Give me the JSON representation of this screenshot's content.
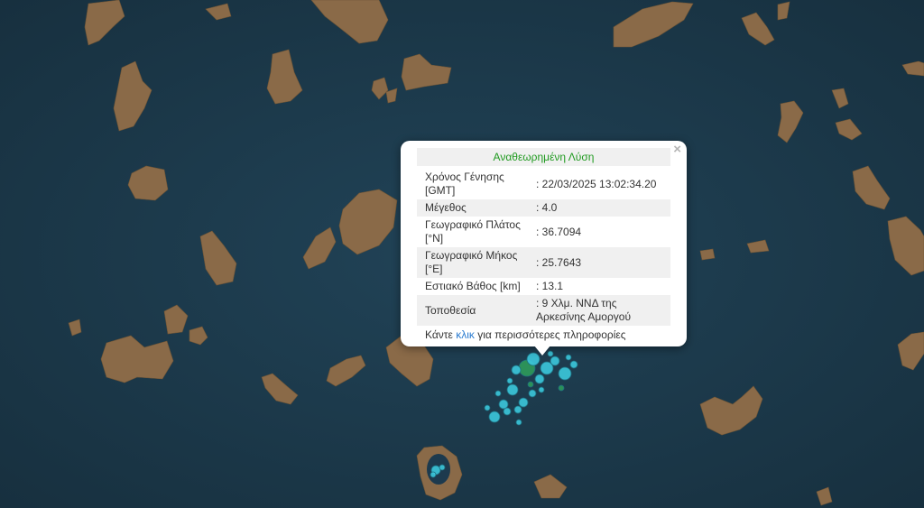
{
  "popup": {
    "title": "Αναθεωρημένη Λύση",
    "close_symbol": "×",
    "rows": [
      {
        "label": "Χρόνος Γένησης [GMT]",
        "value": ": 22/03/2025 13:02:34.20"
      },
      {
        "label": "Μέγεθος",
        "value": ": 4.0"
      },
      {
        "label": "Γεωγραφικό Πλάτος [°N]",
        "value": ": 36.7094"
      },
      {
        "label": "Γεωγραφικό Μήκος [°E]",
        "value": ": 25.7643"
      },
      {
        "label": "Εστιακό Βάθος [km]",
        "value": ": 13.1"
      },
      {
        "label": "Τοποθεσία",
        "value": ": 9 Χλμ. ΝΝΔ της Αρκεσίνης Αμοργού"
      }
    ],
    "more_prefix": "Κάντε ",
    "more_link": "κλικ",
    "more_suffix": " για περισσότερες πληροφορίες"
  },
  "colors": {
    "sea": "#1d3a4e",
    "land": "#8a6a48",
    "marker_cyan": "#3cc8dc",
    "marker_green": "#2e9a5a",
    "title_green": "#1f9a1f",
    "link_blue": "#2a7bd0"
  },
  "icons": {
    "close": "close-icon",
    "marker": "earthquake-marker-icon"
  }
}
